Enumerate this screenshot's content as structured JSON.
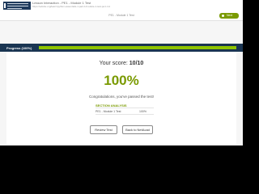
{
  "header": {
    "title": "Lesson Interaction - PE1 - Module 1 Test",
    "url": "https://edube.org/learn/python-essentials-1-part-1/module-1-test-pe1-m1"
  },
  "nav": {
    "breadcrumb": "PE1 - Module 1 Test",
    "next_label": "Next"
  },
  "progress": {
    "label": "Progress (100%)",
    "fraction": 1.0
  },
  "result": {
    "score_label": "Your score:",
    "score_value": "10/10",
    "percent": "100%",
    "message": "Congratulations, you've passed the test!"
  },
  "analysis": {
    "title": "SECTION ANALYSIS",
    "rows": [
      {
        "name": "PE1 - Module 1 Test",
        "value": "100%"
      }
    ]
  },
  "buttons": {
    "review": "Review Test",
    "back": "Back to NetAcad"
  },
  "colors": {
    "accent": "#7a9a01",
    "progress_fill": "#8fc400",
    "progress_bg": "#1a3552",
    "logo": "#1f3a5c"
  }
}
